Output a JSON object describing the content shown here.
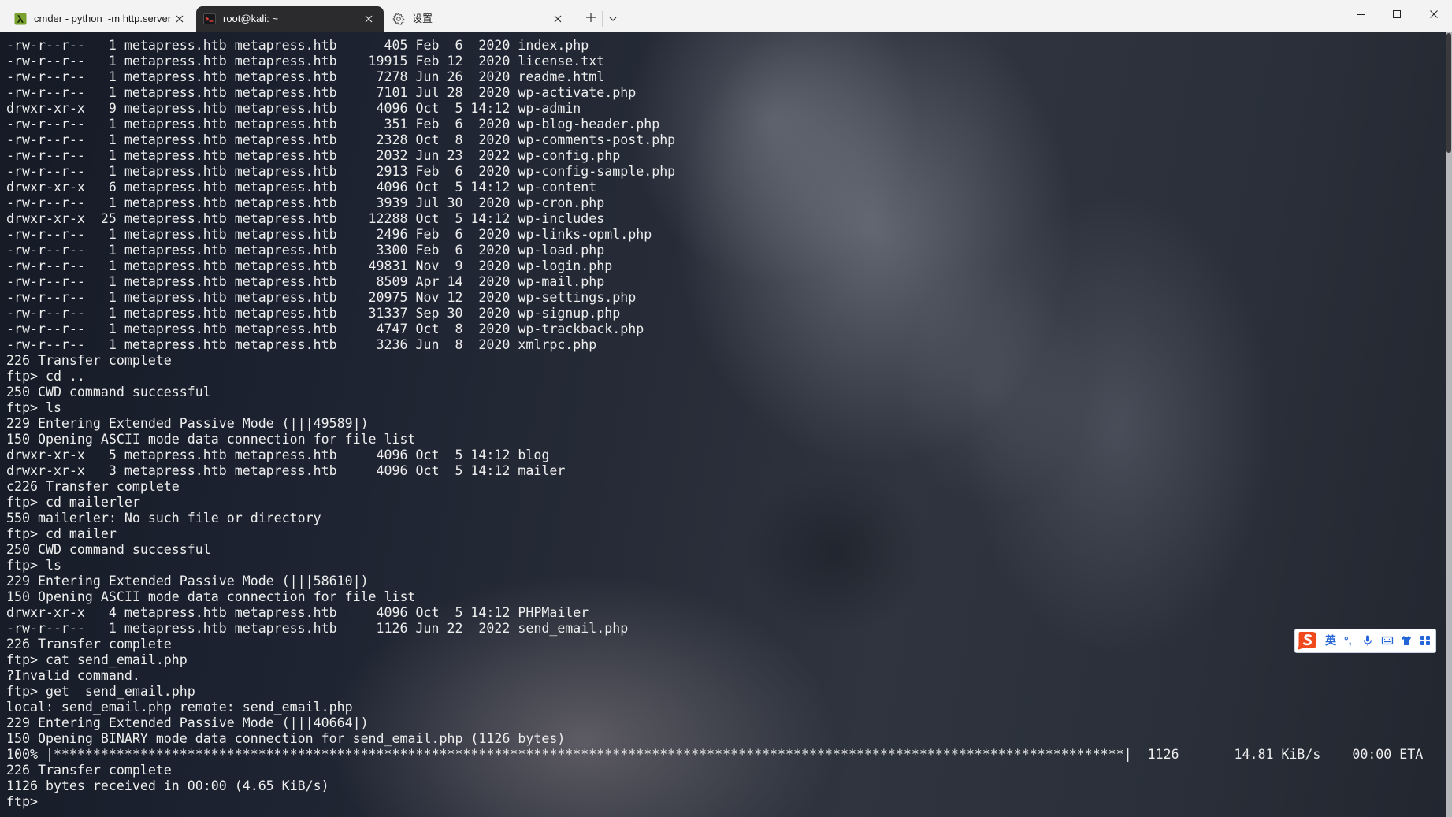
{
  "window": {
    "tabs": [
      {
        "title": "cmder - python  -m http.server",
        "icon": "cmder-lambda-icon",
        "active": false
      },
      {
        "title": "root@kali: ~",
        "icon": "kali-linux-icon",
        "active": true
      },
      {
        "title": "设置",
        "icon": "gear-icon",
        "active": false
      }
    ],
    "tab_actions": {
      "new_tab_icon": "plus-icon",
      "dropdown_icon": "chevron-down-icon"
    },
    "window_controls": {
      "minimize_icon": "minimize-icon",
      "maximize_icon": "maximize-icon",
      "close_icon": "close-icon"
    }
  },
  "terminal": {
    "lines": [
      "-rw-r--r--   1 metapress.htb metapress.htb      405 Feb  6  2020 index.php",
      "-rw-r--r--   1 metapress.htb metapress.htb    19915 Feb 12  2020 license.txt",
      "-rw-r--r--   1 metapress.htb metapress.htb     7278 Jun 26  2020 readme.html",
      "-rw-r--r--   1 metapress.htb metapress.htb     7101 Jul 28  2020 wp-activate.php",
      "drwxr-xr-x   9 metapress.htb metapress.htb     4096 Oct  5 14:12 wp-admin",
      "-rw-r--r--   1 metapress.htb metapress.htb      351 Feb  6  2020 wp-blog-header.php",
      "-rw-r--r--   1 metapress.htb metapress.htb     2328 Oct  8  2020 wp-comments-post.php",
      "-rw-r--r--   1 metapress.htb metapress.htb     2032 Jun 23  2022 wp-config.php",
      "-rw-r--r--   1 metapress.htb metapress.htb     2913 Feb  6  2020 wp-config-sample.php",
      "drwxr-xr-x   6 metapress.htb metapress.htb     4096 Oct  5 14:12 wp-content",
      "-rw-r--r--   1 metapress.htb metapress.htb     3939 Jul 30  2020 wp-cron.php",
      "drwxr-xr-x  25 metapress.htb metapress.htb    12288 Oct  5 14:12 wp-includes",
      "-rw-r--r--   1 metapress.htb metapress.htb     2496 Feb  6  2020 wp-links-opml.php",
      "-rw-r--r--   1 metapress.htb metapress.htb     3300 Feb  6  2020 wp-load.php",
      "-rw-r--r--   1 metapress.htb metapress.htb    49831 Nov  9  2020 wp-login.php",
      "-rw-r--r--   1 metapress.htb metapress.htb     8509 Apr 14  2020 wp-mail.php",
      "-rw-r--r--   1 metapress.htb metapress.htb    20975 Nov 12  2020 wp-settings.php",
      "-rw-r--r--   1 metapress.htb metapress.htb    31337 Sep 30  2020 wp-signup.php",
      "-rw-r--r--   1 metapress.htb metapress.htb     4747 Oct  8  2020 wp-trackback.php",
      "-rw-r--r--   1 metapress.htb metapress.htb     3236 Jun  8  2020 xmlrpc.php",
      "226 Transfer complete",
      "ftp> cd ..",
      "250 CWD command successful",
      "ftp> ls",
      "229 Entering Extended Passive Mode (|||49589|)",
      "150 Opening ASCII mode data connection for file list",
      "drwxr-xr-x   5 metapress.htb metapress.htb     4096 Oct  5 14:12 blog",
      "drwxr-xr-x   3 metapress.htb metapress.htb     4096 Oct  5 14:12 mailer",
      "c226 Transfer complete",
      "ftp> cd mailerler",
      "550 mailerler: No such file or directory",
      "ftp> cd mailer",
      "250 CWD command successful",
      "ftp> ls",
      "229 Entering Extended Passive Mode (|||58610|)",
      "150 Opening ASCII mode data connection for file list",
      "drwxr-xr-x   4 metapress.htb metapress.htb     4096 Oct  5 14:12 PHPMailer",
      "-rw-r--r--   1 metapress.htb metapress.htb     1126 Jun 22  2022 send_email.php",
      "226 Transfer complete",
      "ftp> cat send_email.php",
      "?Invalid command.",
      "ftp> get  send_email.php",
      "local: send_email.php remote: send_email.php",
      "229 Entering Extended Passive Mode (|||40664|)",
      "150 Opening BINARY mode data connection for send_email.php (1126 bytes)",
      "100% |****************************************************************************************************************************************|  1126       14.81 KiB/s    00:00 ETA",
      "226 Transfer complete",
      "1126 bytes received in 00:00 (4.65 KiB/s)",
      "ftp> "
    ]
  },
  "ime_toolbar": {
    "logo": "S",
    "logo_icon": "sogou-logo-icon",
    "mode_label": "英",
    "punctuation_label": "°,",
    "icons": [
      "microphone-icon",
      "keyboard-icon",
      "skin-shirt-icon",
      "toolbox-grid-icon"
    ]
  },
  "colors": {
    "tab_bar_bg": "#f3f3f3",
    "active_tab_bg": "#2b2b2e",
    "terminal_text": "#eeeeee",
    "ime_blue": "#2466d8",
    "sogou_orange": "#f04a1c"
  }
}
